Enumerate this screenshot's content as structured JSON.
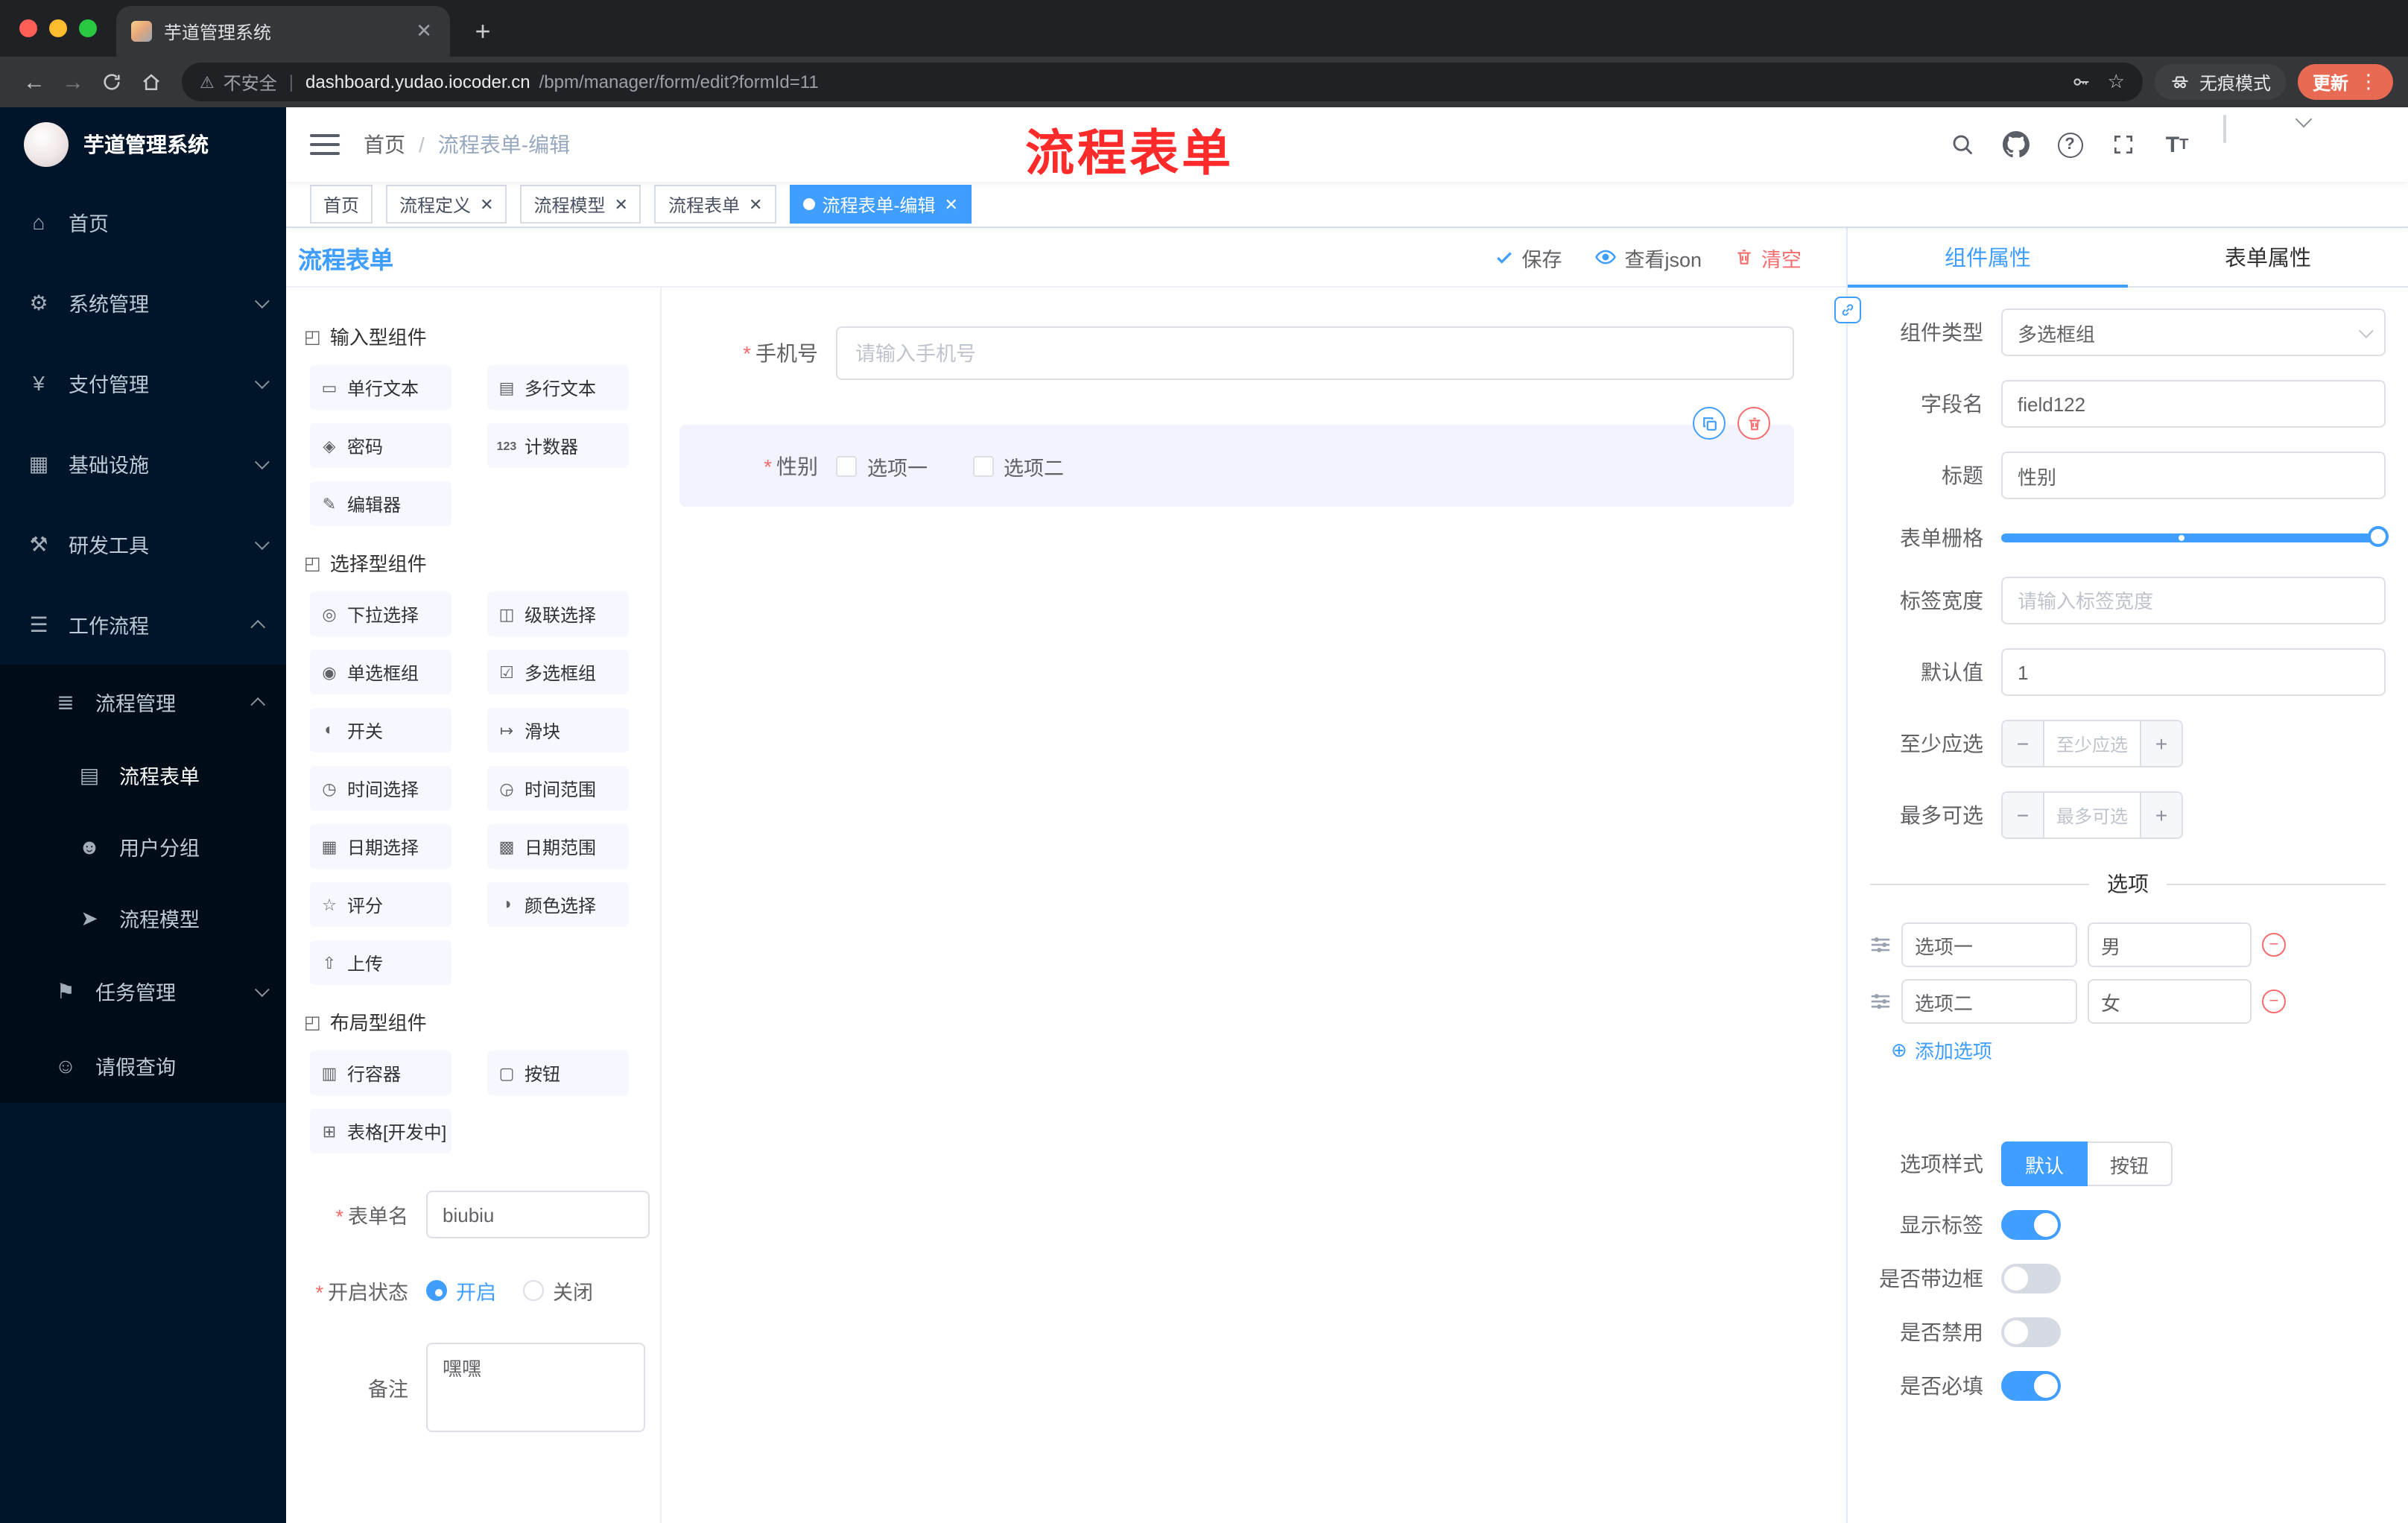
{
  "colors": {
    "accent": "#409eff",
    "danger": "#f56c6c",
    "sidebar_bg": "#001529",
    "annotation": "#ff2b2b",
    "tag_active_bg": "#409eff"
  },
  "browser": {
    "tab_title": "芋道管理系统",
    "security_label": "不安全",
    "url_host": "dashboard.yudao.iocoder.cn",
    "url_path": "/bpm/manager/form/edit?formId=11",
    "incognito_label": "无痕模式",
    "update_label": "更新"
  },
  "annotation_text": "流程表单",
  "sidebar": {
    "logo_title": "芋道管理系统",
    "items": [
      {
        "glyph": "⌂",
        "label": "首页"
      },
      {
        "glyph": "⚙",
        "label": "系统管理"
      },
      {
        "glyph": "¥",
        "label": "支付管理"
      },
      {
        "glyph": "▦",
        "label": "基础设施"
      },
      {
        "glyph": "⚒",
        "label": "研发工具"
      },
      {
        "glyph": "☰",
        "label": "工作流程"
      },
      {
        "glyph": "≣",
        "label": "流程管理"
      },
      {
        "glyph": "▤",
        "label": "流程表单"
      },
      {
        "glyph": "☻",
        "label": "用户分组"
      },
      {
        "glyph": "➤",
        "label": "流程模型"
      },
      {
        "glyph": "⚑",
        "label": "任务管理"
      },
      {
        "glyph": "☺",
        "label": "请假查询"
      }
    ]
  },
  "header": {
    "breadcrumb_home": "首页",
    "breadcrumb_current": "流程表单-编辑"
  },
  "tags": [
    {
      "label": "首页"
    },
    {
      "label": "流程定义"
    },
    {
      "label": "流程模型"
    },
    {
      "label": "流程表单"
    },
    {
      "label": "流程表单-编辑"
    }
  ],
  "designer": {
    "panel_title": "流程表单",
    "save_label": "保存",
    "view_json_label": "查看json",
    "clear_label": "清空",
    "groups": [
      {
        "title": "输入型组件",
        "items": [
          {
            "glyph": "▭",
            "label": "单行文本"
          },
          {
            "glyph": "▤",
            "label": "多行文本"
          },
          {
            "glyph": "◈",
            "label": "密码"
          },
          {
            "glyph": "123",
            "label": "计数器"
          },
          {
            "glyph": "✎",
            "label": "编辑器"
          }
        ]
      },
      {
        "title": "选择型组件",
        "items": [
          {
            "glyph": "◎",
            "label": "下拉选择"
          },
          {
            "glyph": "◫",
            "label": "级联选择"
          },
          {
            "glyph": "◉",
            "label": "单选框组"
          },
          {
            "glyph": "☑",
            "label": "多选框组"
          },
          {
            "glyph": "◐",
            "label": "开关"
          },
          {
            "glyph": "↦",
            "label": "滑块"
          },
          {
            "glyph": "◷",
            "label": "时间选择"
          },
          {
            "glyph": "◶",
            "label": "时间范围"
          },
          {
            "glyph": "▦",
            "label": "日期选择"
          },
          {
            "glyph": "▩",
            "label": "日期范围"
          },
          {
            "glyph": "☆",
            "label": "评分"
          },
          {
            "glyph": "◑",
            "label": "颜色选择"
          },
          {
            "glyph": "⇧",
            "label": "上传"
          }
        ]
      },
      {
        "title": "布局型组件",
        "items": [
          {
            "glyph": "▥",
            "label": "行容器"
          },
          {
            "glyph": "▢",
            "label": "按钮"
          },
          {
            "glyph": "⊞",
            "label": "表格[开发中]"
          }
        ]
      }
    ],
    "meta_form": {
      "name_label": "表单名",
      "name_value": "biubiu",
      "status_label": "开启状态",
      "status_on": "开启",
      "status_off": "关闭",
      "remark_label": "备注",
      "remark_value": "嘿嘿"
    },
    "canvas": {
      "phone_label": "手机号",
      "phone_placeholder": "请输入手机号",
      "gender_label": "性别",
      "gender_options": [
        "选项一",
        "选项二"
      ]
    }
  },
  "inspector": {
    "tab_component": "组件属性",
    "tab_form": "表单属性",
    "component_type_label": "组件类型",
    "component_type_value": "多选框组",
    "field_name_label": "字段名",
    "field_name_value": "field122",
    "title_label": "标题",
    "title_value": "性别",
    "grid_label": "表单栅格",
    "label_width_label": "标签宽度",
    "label_width_placeholder": "请输入标签宽度",
    "default_label": "默认值",
    "default_value": "1",
    "min_label": "至少应选",
    "min_placeholder": "至少应选",
    "max_label": "最多可选",
    "max_placeholder": "最多可选",
    "options_divider": "选项",
    "option_rows": [
      {
        "label": "选项一",
        "value": "男"
      },
      {
        "label": "选项二",
        "value": "女"
      }
    ],
    "add_option_label": "添加选项",
    "style_label": "选项样式",
    "style_default": "默认",
    "style_button": "按钮",
    "switch_show_label": "显示标签",
    "switch_border": "是否带边框",
    "switch_disabled": "是否禁用",
    "switch_required": "是否必填"
  }
}
